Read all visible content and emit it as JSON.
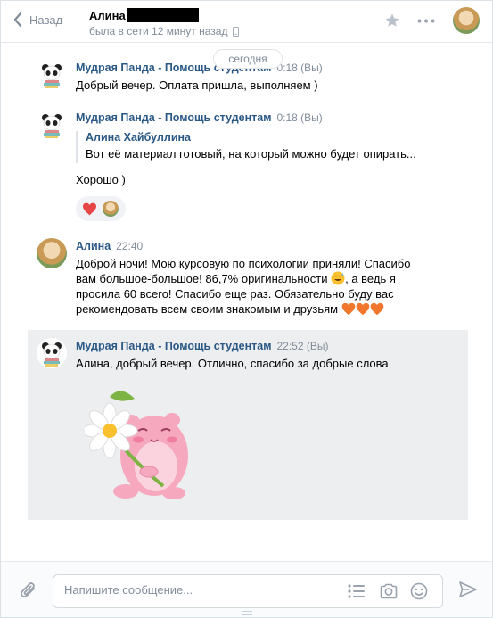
{
  "header": {
    "back_label": "Назад",
    "peer_name": "Алина",
    "peer_status": "была в сети 12 минут назад"
  },
  "date_divider": "сегодня",
  "messages": [
    {
      "author": "Мудрая Панда - Помощь студентам",
      "time": "0:18 (Вы)",
      "text": "Добрый вечер. Оплата пришла, выполняем )"
    },
    {
      "author": "Мудрая Панда - Помощь студентам",
      "time": "0:18 (Вы)",
      "quote_author": "Алина Хайбуллина",
      "quote_text": "Вот её материал готовый, на который можно будет опирать...",
      "text": "Хорошо )",
      "reaction": "❤️"
    },
    {
      "author": "Алина",
      "time": "22:40",
      "text_lines": [
        "Доброй ночи! Мою курсовую по психологии приняли! Спасибо",
        "вам большое-большое! 86,7% оригинальности",
        ", а ведь я",
        "просила 60 всего! Спасибо еще раз. Обязательно буду вас",
        "рекомендовать всем своим знакомым и друзьям"
      ]
    },
    {
      "author": "Мудрая Панда - Помощь студентам",
      "time": "22:52 (Вы)",
      "text": "Алина, добрый вечер. Отлично, спасибо за добрые слова",
      "sticker": "pink-hamster-with-daisy"
    }
  ],
  "composer": {
    "placeholder": "Напишите сообщение..."
  },
  "icons": [
    "back-chevron-icon",
    "star-icon",
    "more-icon",
    "phone-icon",
    "paperclip-icon",
    "list-icon",
    "camera-icon",
    "smile-icon",
    "send-icon"
  ],
  "colors": {
    "link": "#2a5885",
    "muted": "#818c99",
    "highlight": "#edeef0",
    "heart": "#e64646"
  }
}
